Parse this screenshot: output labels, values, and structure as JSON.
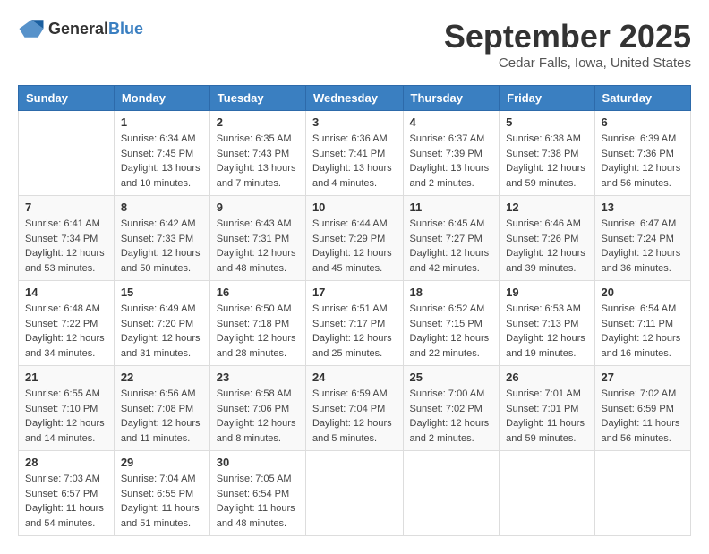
{
  "header": {
    "logo_general": "General",
    "logo_blue": "Blue",
    "month_title": "September 2025",
    "location": "Cedar Falls, Iowa, United States"
  },
  "weekdays": [
    "Sunday",
    "Monday",
    "Tuesday",
    "Wednesday",
    "Thursday",
    "Friday",
    "Saturday"
  ],
  "weeks": [
    [
      {
        "day": "",
        "sunrise": "",
        "sunset": "",
        "daylight": ""
      },
      {
        "day": "1",
        "sunrise": "Sunrise: 6:34 AM",
        "sunset": "Sunset: 7:45 PM",
        "daylight": "Daylight: 13 hours and 10 minutes."
      },
      {
        "day": "2",
        "sunrise": "Sunrise: 6:35 AM",
        "sunset": "Sunset: 7:43 PM",
        "daylight": "Daylight: 13 hours and 7 minutes."
      },
      {
        "day": "3",
        "sunrise": "Sunrise: 6:36 AM",
        "sunset": "Sunset: 7:41 PM",
        "daylight": "Daylight: 13 hours and 4 minutes."
      },
      {
        "day": "4",
        "sunrise": "Sunrise: 6:37 AM",
        "sunset": "Sunset: 7:39 PM",
        "daylight": "Daylight: 13 hours and 2 minutes."
      },
      {
        "day": "5",
        "sunrise": "Sunrise: 6:38 AM",
        "sunset": "Sunset: 7:38 PM",
        "daylight": "Daylight: 12 hours and 59 minutes."
      },
      {
        "day": "6",
        "sunrise": "Sunrise: 6:39 AM",
        "sunset": "Sunset: 7:36 PM",
        "daylight": "Daylight: 12 hours and 56 minutes."
      }
    ],
    [
      {
        "day": "7",
        "sunrise": "Sunrise: 6:41 AM",
        "sunset": "Sunset: 7:34 PM",
        "daylight": "Daylight: 12 hours and 53 minutes."
      },
      {
        "day": "8",
        "sunrise": "Sunrise: 6:42 AM",
        "sunset": "Sunset: 7:33 PM",
        "daylight": "Daylight: 12 hours and 50 minutes."
      },
      {
        "day": "9",
        "sunrise": "Sunrise: 6:43 AM",
        "sunset": "Sunset: 7:31 PM",
        "daylight": "Daylight: 12 hours and 48 minutes."
      },
      {
        "day": "10",
        "sunrise": "Sunrise: 6:44 AM",
        "sunset": "Sunset: 7:29 PM",
        "daylight": "Daylight: 12 hours and 45 minutes."
      },
      {
        "day": "11",
        "sunrise": "Sunrise: 6:45 AM",
        "sunset": "Sunset: 7:27 PM",
        "daylight": "Daylight: 12 hours and 42 minutes."
      },
      {
        "day": "12",
        "sunrise": "Sunrise: 6:46 AM",
        "sunset": "Sunset: 7:26 PM",
        "daylight": "Daylight: 12 hours and 39 minutes."
      },
      {
        "day": "13",
        "sunrise": "Sunrise: 6:47 AM",
        "sunset": "Sunset: 7:24 PM",
        "daylight": "Daylight: 12 hours and 36 minutes."
      }
    ],
    [
      {
        "day": "14",
        "sunrise": "Sunrise: 6:48 AM",
        "sunset": "Sunset: 7:22 PM",
        "daylight": "Daylight: 12 hours and 34 minutes."
      },
      {
        "day": "15",
        "sunrise": "Sunrise: 6:49 AM",
        "sunset": "Sunset: 7:20 PM",
        "daylight": "Daylight: 12 hours and 31 minutes."
      },
      {
        "day": "16",
        "sunrise": "Sunrise: 6:50 AM",
        "sunset": "Sunset: 7:18 PM",
        "daylight": "Daylight: 12 hours and 28 minutes."
      },
      {
        "day": "17",
        "sunrise": "Sunrise: 6:51 AM",
        "sunset": "Sunset: 7:17 PM",
        "daylight": "Daylight: 12 hours and 25 minutes."
      },
      {
        "day": "18",
        "sunrise": "Sunrise: 6:52 AM",
        "sunset": "Sunset: 7:15 PM",
        "daylight": "Daylight: 12 hours and 22 minutes."
      },
      {
        "day": "19",
        "sunrise": "Sunrise: 6:53 AM",
        "sunset": "Sunset: 7:13 PM",
        "daylight": "Daylight: 12 hours and 19 minutes."
      },
      {
        "day": "20",
        "sunrise": "Sunrise: 6:54 AM",
        "sunset": "Sunset: 7:11 PM",
        "daylight": "Daylight: 12 hours and 16 minutes."
      }
    ],
    [
      {
        "day": "21",
        "sunrise": "Sunrise: 6:55 AM",
        "sunset": "Sunset: 7:10 PM",
        "daylight": "Daylight: 12 hours and 14 minutes."
      },
      {
        "day": "22",
        "sunrise": "Sunrise: 6:56 AM",
        "sunset": "Sunset: 7:08 PM",
        "daylight": "Daylight: 12 hours and 11 minutes."
      },
      {
        "day": "23",
        "sunrise": "Sunrise: 6:58 AM",
        "sunset": "Sunset: 7:06 PM",
        "daylight": "Daylight: 12 hours and 8 minutes."
      },
      {
        "day": "24",
        "sunrise": "Sunrise: 6:59 AM",
        "sunset": "Sunset: 7:04 PM",
        "daylight": "Daylight: 12 hours and 5 minutes."
      },
      {
        "day": "25",
        "sunrise": "Sunrise: 7:00 AM",
        "sunset": "Sunset: 7:02 PM",
        "daylight": "Daylight: 12 hours and 2 minutes."
      },
      {
        "day": "26",
        "sunrise": "Sunrise: 7:01 AM",
        "sunset": "Sunset: 7:01 PM",
        "daylight": "Daylight: 11 hours and 59 minutes."
      },
      {
        "day": "27",
        "sunrise": "Sunrise: 7:02 AM",
        "sunset": "Sunset: 6:59 PM",
        "daylight": "Daylight: 11 hours and 56 minutes."
      }
    ],
    [
      {
        "day": "28",
        "sunrise": "Sunrise: 7:03 AM",
        "sunset": "Sunset: 6:57 PM",
        "daylight": "Daylight: 11 hours and 54 minutes."
      },
      {
        "day": "29",
        "sunrise": "Sunrise: 7:04 AM",
        "sunset": "Sunset: 6:55 PM",
        "daylight": "Daylight: 11 hours and 51 minutes."
      },
      {
        "day": "30",
        "sunrise": "Sunrise: 7:05 AM",
        "sunset": "Sunset: 6:54 PM",
        "daylight": "Daylight: 11 hours and 48 minutes."
      },
      {
        "day": "",
        "sunrise": "",
        "sunset": "",
        "daylight": ""
      },
      {
        "day": "",
        "sunrise": "",
        "sunset": "",
        "daylight": ""
      },
      {
        "day": "",
        "sunrise": "",
        "sunset": "",
        "daylight": ""
      },
      {
        "day": "",
        "sunrise": "",
        "sunset": "",
        "daylight": ""
      }
    ]
  ]
}
